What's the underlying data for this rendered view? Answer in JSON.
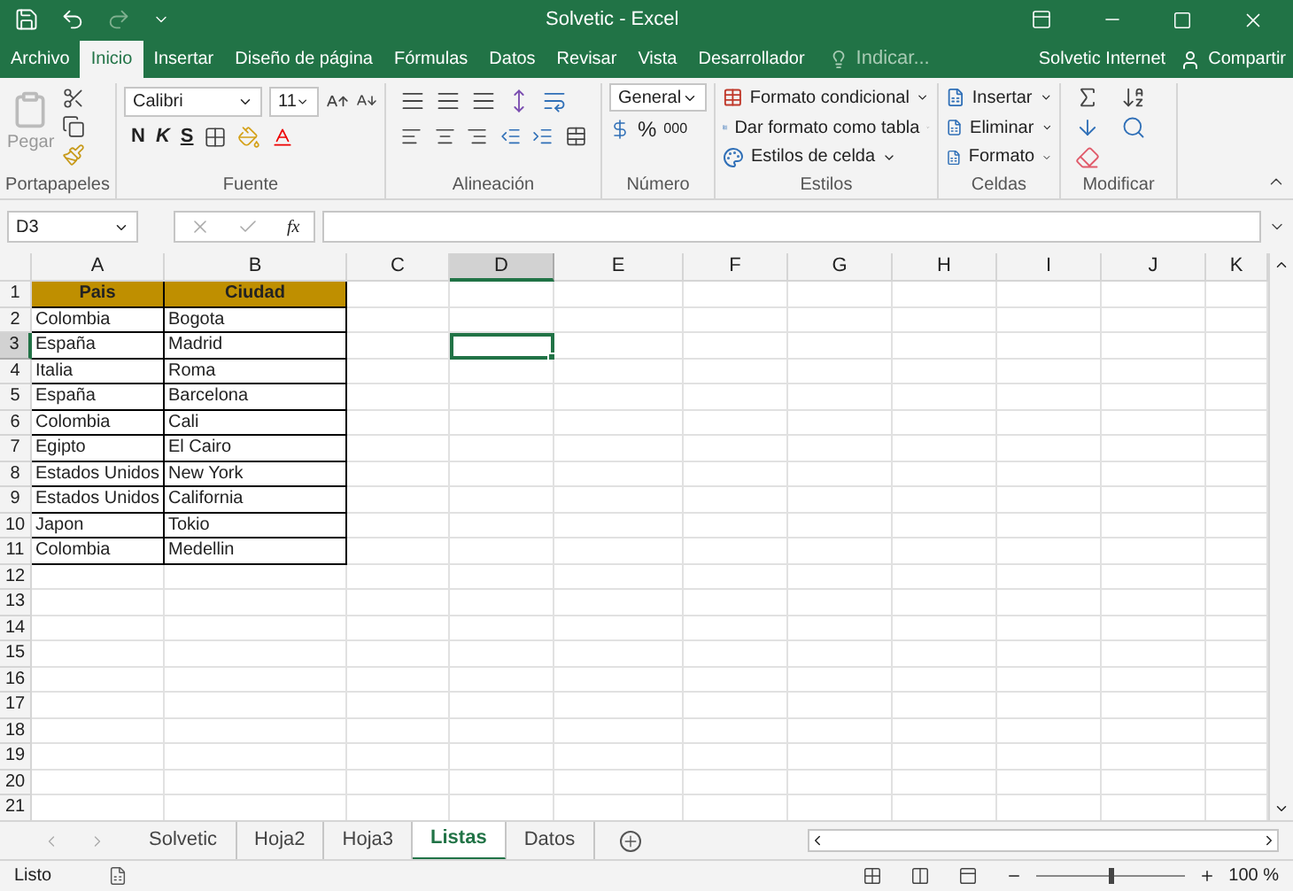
{
  "window": {
    "title": "Solvetic - Excel"
  },
  "ribbon_tabs": [
    {
      "label": "Archivo",
      "selected": false
    },
    {
      "label": "Inicio",
      "selected": true
    },
    {
      "label": "Insertar",
      "selected": false
    },
    {
      "label": "Diseño de página",
      "selected": false
    },
    {
      "label": "Fórmulas",
      "selected": false
    },
    {
      "label": "Datos",
      "selected": false
    },
    {
      "label": "Revisar",
      "selected": false
    },
    {
      "label": "Vista",
      "selected": false
    },
    {
      "label": "Desarrollador",
      "selected": false
    }
  ],
  "tell_me": {
    "placeholder": "Indicar..."
  },
  "account": "Solvetic Internet",
  "share": "Compartir",
  "clipboard": {
    "paste": "Pegar",
    "label": "Portapapeles"
  },
  "font": {
    "name": "Calibri",
    "size": "11",
    "bold": "N",
    "italic": "K",
    "underline": "S",
    "label": "Fuente"
  },
  "alignment": {
    "label": "Alineación"
  },
  "number": {
    "format": "General",
    "percent": "%",
    "thousands": "000",
    "label": "Número"
  },
  "styles": {
    "items": [
      "Formato condicional",
      "Dar formato como tabla",
      "Estilos de celda"
    ],
    "label": "Estilos"
  },
  "cells": {
    "items": [
      "Insertar",
      "Eliminar",
      "Formato"
    ],
    "label": "Celdas"
  },
  "editing": {
    "label": "Modificar"
  },
  "formula_bar": {
    "name_box": "D3",
    "function_label": "fx"
  },
  "columns": [
    {
      "label": "A",
      "selected": false
    },
    {
      "label": "B",
      "selected": false
    },
    {
      "label": "C",
      "selected": false
    },
    {
      "label": "D",
      "selected": true
    },
    {
      "label": "E",
      "selected": false
    },
    {
      "label": "F",
      "selected": false
    },
    {
      "label": "G",
      "selected": false
    },
    {
      "label": "H",
      "selected": false
    },
    {
      "label": "I",
      "selected": false
    },
    {
      "label": "J",
      "selected": false
    },
    {
      "label": "K",
      "selected": false
    }
  ],
  "rows": [
    {
      "label": "1",
      "selected": false,
      "cells": [
        "Pais",
        "Ciudad"
      ]
    },
    {
      "label": "2",
      "selected": false,
      "cells": [
        "Colombia",
        "Bogota"
      ]
    },
    {
      "label": "3",
      "selected": true,
      "cells": [
        "España",
        "Madrid"
      ]
    },
    {
      "label": "4",
      "selected": false,
      "cells": [
        "Italia",
        "Roma"
      ]
    },
    {
      "label": "5",
      "selected": false,
      "cells": [
        "España",
        "Barcelona"
      ]
    },
    {
      "label": "6",
      "selected": false,
      "cells": [
        "Colombia",
        "Cali"
      ]
    },
    {
      "label": "7",
      "selected": false,
      "cells": [
        "Egipto",
        "El Cairo"
      ]
    },
    {
      "label": "8",
      "selected": false,
      "cells": [
        "Estados Unidos",
        "New York"
      ]
    },
    {
      "label": "9",
      "selected": false,
      "cells": [
        "Estados Unidos",
        "California"
      ]
    },
    {
      "label": "10",
      "selected": false,
      "cells": [
        "Japon",
        "Tokio"
      ]
    },
    {
      "label": "11",
      "selected": false,
      "cells": [
        "Colombia",
        "Medellin"
      ]
    },
    {
      "label": "12",
      "selected": false,
      "cells": []
    },
    {
      "label": "13",
      "selected": false,
      "cells": []
    },
    {
      "label": "14",
      "selected": false,
      "cells": []
    },
    {
      "label": "15",
      "selected": false,
      "cells": []
    },
    {
      "label": "16",
      "selected": false,
      "cells": []
    },
    {
      "label": "17",
      "selected": false,
      "cells": []
    },
    {
      "label": "18",
      "selected": false,
      "cells": []
    },
    {
      "label": "19",
      "selected": false,
      "cells": []
    },
    {
      "label": "20",
      "selected": false,
      "cells": []
    },
    {
      "label": "21",
      "selected": false,
      "cells": []
    }
  ],
  "sheet_tabs": [
    {
      "label": "Solvetic",
      "selected": false
    },
    {
      "label": "Hoja2",
      "selected": false
    },
    {
      "label": "Hoja3",
      "selected": false
    },
    {
      "label": "Listas",
      "selected": true
    },
    {
      "label": "Datos",
      "selected": false
    }
  ],
  "status_bar": {
    "status": "Listo",
    "zoom": "100 %",
    "zoom_level": {
      "level": 0.5
    }
  }
}
